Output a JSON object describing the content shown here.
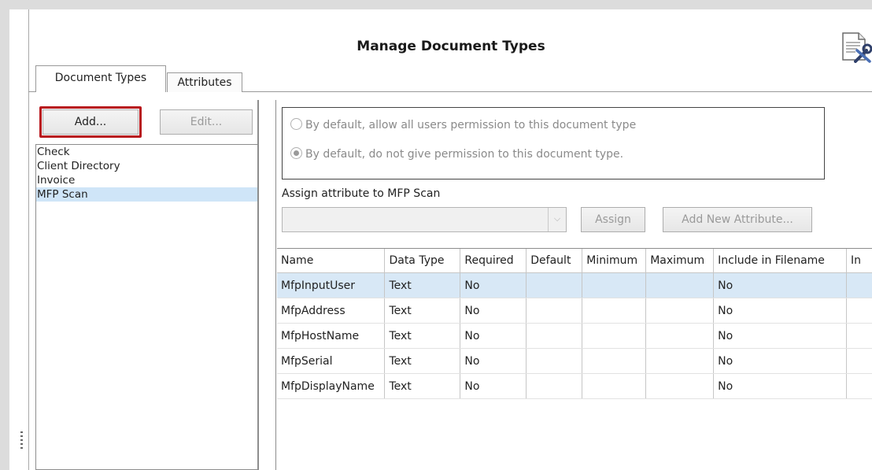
{
  "window": {
    "title": "Manage Document Types",
    "title_icon": "document-tools-icon"
  },
  "tabs": [
    {
      "label": "Document Types",
      "active": true
    },
    {
      "label": "Attributes",
      "active": false
    }
  ],
  "left_panel": {
    "add_label": "Add...",
    "edit_label": "Edit...",
    "documents": [
      "Check",
      "Client Directory",
      "Invoice",
      "MFP Scan"
    ],
    "selected_index": 3
  },
  "permissions": {
    "option_allow": "By default, allow all users permission to this document type",
    "option_deny": "By default, do not give permission to this document type.",
    "selected": "deny"
  },
  "assign": {
    "label": "Assign attribute to MFP Scan",
    "combo_value": "",
    "assign_label": "Assign",
    "add_new_label": "Add New Attribute..."
  },
  "grid": {
    "columns": [
      "Name",
      "Data Type",
      "Required",
      "Default",
      "Minimum",
      "Maximum",
      "Include in Filename",
      "In"
    ],
    "rows": [
      [
        "MfpInputUser",
        "Text",
        "No",
        "",
        "",
        "",
        "No",
        ""
      ],
      [
        "MfpAddress",
        "Text",
        "No",
        "",
        "",
        "",
        "No",
        ""
      ],
      [
        "MfpHostName",
        "Text",
        "No",
        "",
        "",
        "",
        "No",
        ""
      ],
      [
        "MfpSerial",
        "Text",
        "No",
        "",
        "",
        "",
        "No",
        ""
      ],
      [
        "MfpDisplayName",
        "Text",
        "No",
        "",
        "",
        "",
        "No",
        ""
      ]
    ],
    "selected_row": 0
  },
  "colors": {
    "highlight": "#b8151b",
    "selection": "#cfe5f8"
  }
}
